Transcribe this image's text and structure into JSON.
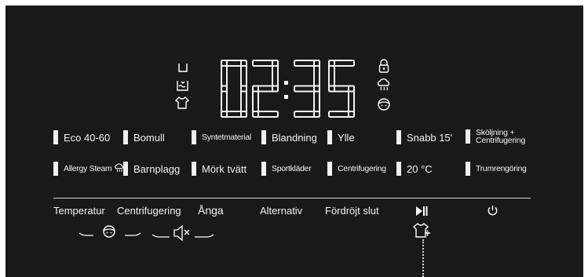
{
  "display": {
    "time_digits": [
      "0",
      "2",
      "3",
      "5"
    ],
    "time_separator": ":",
    "left_icons": [
      "prewash-icon",
      "soak-icon",
      "shirt-icon"
    ],
    "right_icons": [
      "child-lock-icon",
      "steam-icon",
      "baby-face-icon"
    ]
  },
  "programs": [
    {
      "label": "Eco 40-60"
    },
    {
      "label": "Bomull"
    },
    {
      "label": "Syntetmaterial"
    },
    {
      "label": "Blandning"
    },
    {
      "label": "Ylle"
    },
    {
      "label": "Snabb 15'"
    },
    {
      "label_line1": "Sköljning +",
      "label_line2": "Centrifugering"
    },
    {
      "label": "Allergy Steam"
    },
    {
      "label": "Barnplagg"
    },
    {
      "label": "Mörk tvätt"
    },
    {
      "label": "Sportkläder"
    },
    {
      "label": "Centrifugering"
    },
    {
      "label": "20 °C"
    },
    {
      "label": "Trumrengöring"
    }
  ],
  "functions": {
    "temperature": "Temperatur",
    "spin": "Centrifugering",
    "steam": "Ånga",
    "options": "Alternativ",
    "delay_end": "Fördröjt slut",
    "start_pause_icon": "play-pause-icon",
    "power_icon": "power-icon"
  },
  "indicators": [
    "child-lock-hold-icon",
    "mute-hold-icon",
    "shirt-plus-icon"
  ],
  "colors": {
    "panel": "#1a1919",
    "foreground": "#f2f2f2",
    "divider": "#d6d6d6"
  }
}
